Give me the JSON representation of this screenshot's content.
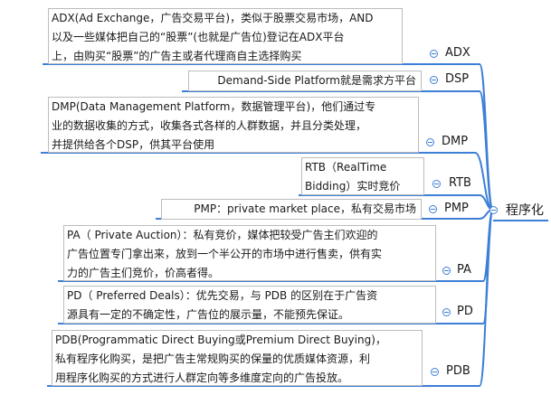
{
  "root": {
    "label": "程序化"
  },
  "topics": [
    {
      "key": "adx",
      "label": "ADX",
      "note": "ADX(Ad Exchange，广告交易平台)，类似于股票交易市场，AND\n以及一些媒体把自己的“股票”(也就是广告位)登记在ADX平台\n上，由购买“股票”的广告主或者代理商自主选择购买"
    },
    {
      "key": "dsp",
      "label": "DSP",
      "note": "Demand-Side Platform就是需求方平台"
    },
    {
      "key": "dmp",
      "label": "DMP",
      "note": "DMP(Data Management Platform，数据管理平台)，他们通过专\n业的数据收集的方式，收集各式各样的人群数据，并且分类处理，\n并提供给各个DSP，供其平台使用"
    },
    {
      "key": "rtb",
      "label": "RTB",
      "note": "RTB（RealTime\nBidding）实时竞价"
    },
    {
      "key": "pmp",
      "label": "PMP",
      "note": "PMP：private market place，私有交易市场"
    },
    {
      "key": "pa",
      "label": "PA",
      "note": "PA（ Private Auction）：私有竞价，媒体把较受广告主们欢迎的\n广告位置专门拿出来，放到一个半公开的市场中进行售卖，供有实\n力的广告主们竞价，价高者得。"
    },
    {
      "key": "pd",
      "label": "PD",
      "note": "PD（ Preferred Deals）：优先交易，与 PDB 的区别在于广告资\n源具有一定的不确定性，广告位的展示量，不能预先保证。"
    },
    {
      "key": "pdb",
      "label": "PDB",
      "note": "PDB(Programmatic Direct Buying或Premium Direct Buying)，\n私有程序化购买，是把广告主常规购买的保量的优质媒体资源，利\n用程序化购买的方式进行人群定向等多维度定向的广告投放。"
    }
  ],
  "colors": {
    "branch": "#3d7fd6",
    "note_border": "#bcbcbc",
    "text": "#1a1a1a"
  }
}
